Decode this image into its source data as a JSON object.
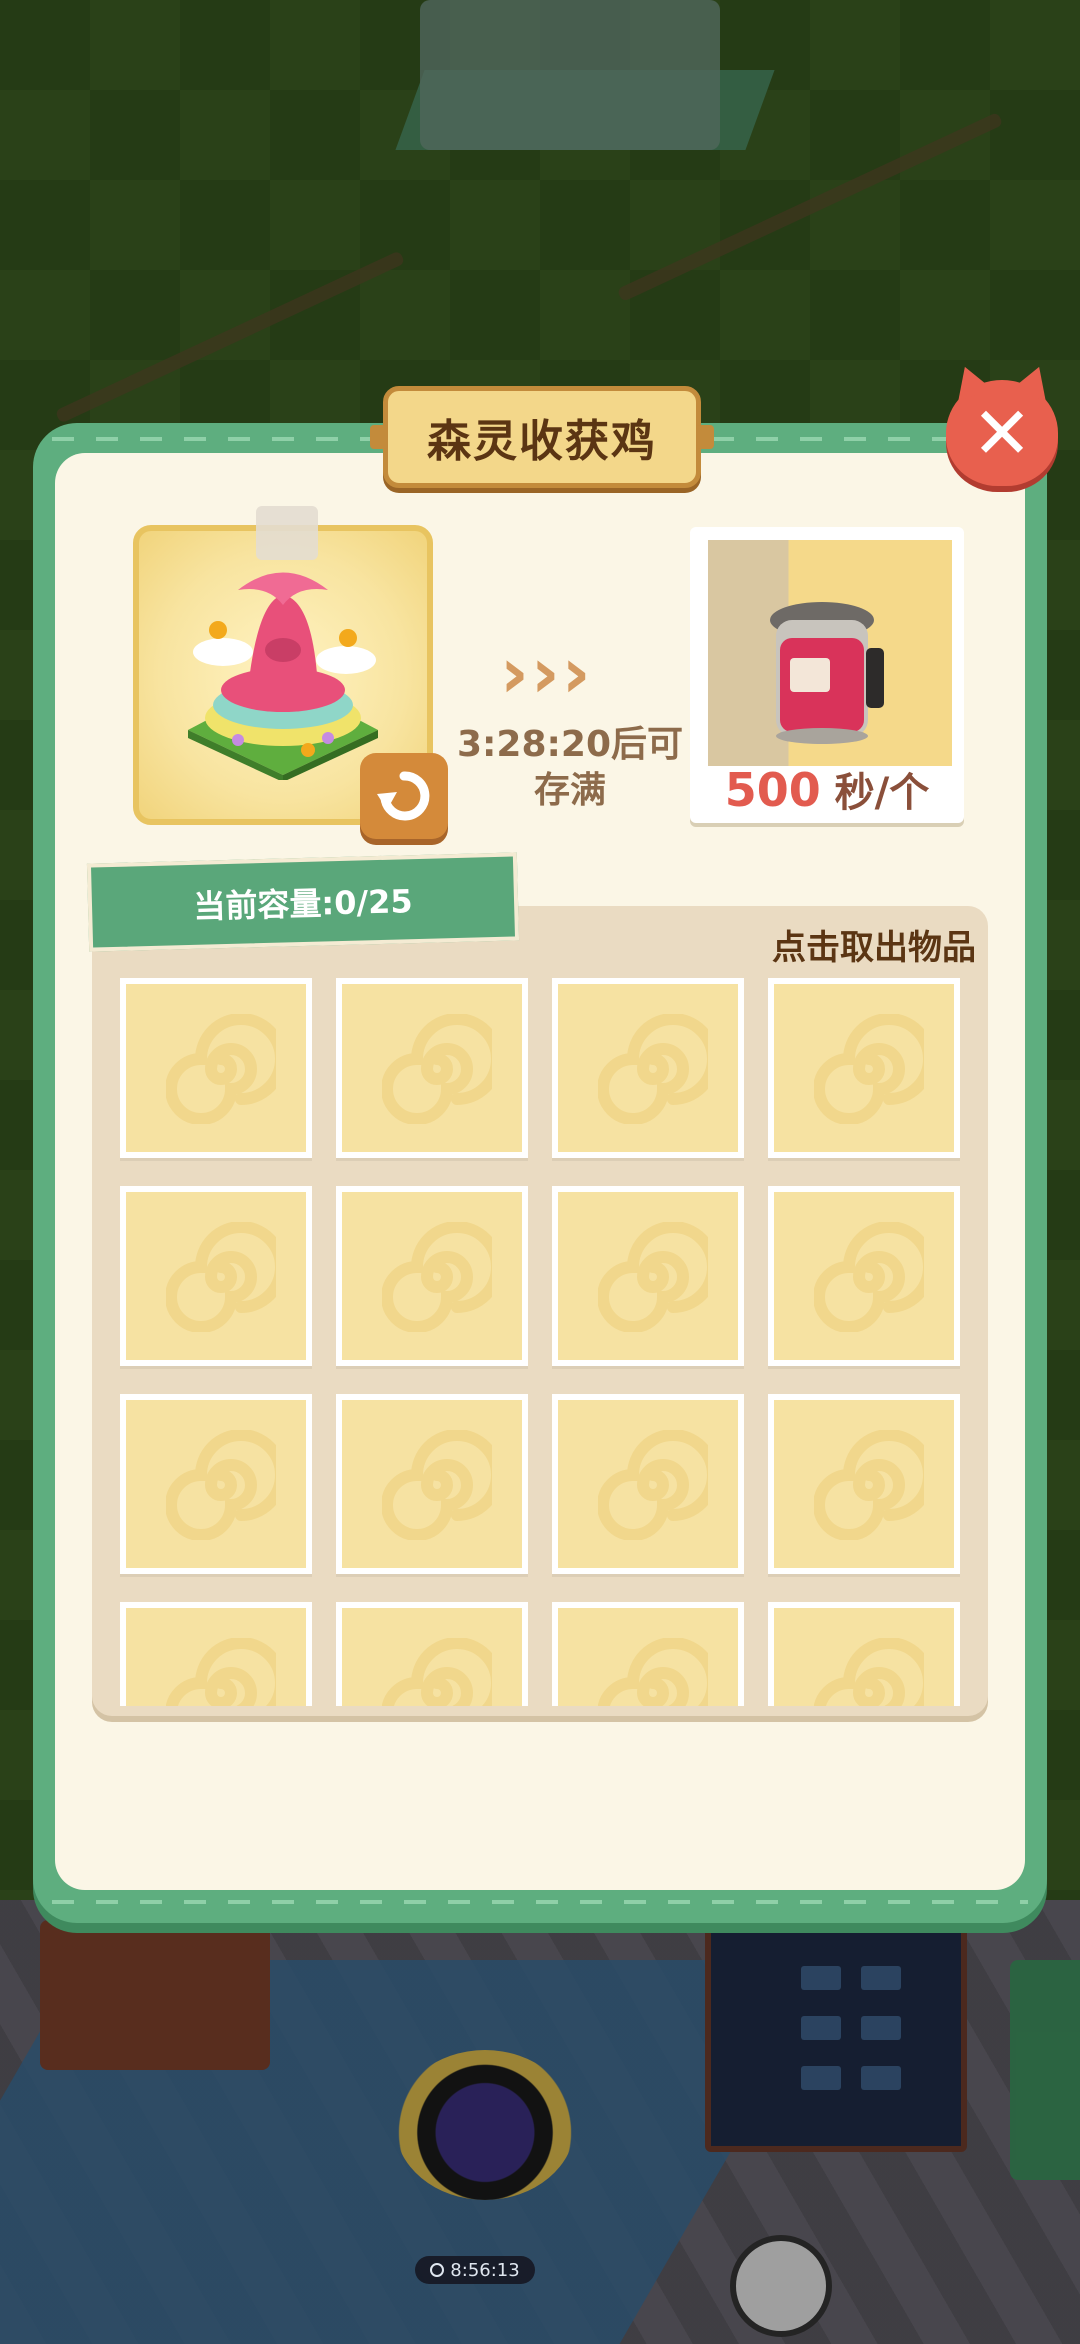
{
  "dialog": {
    "title": "森灵收获鸡",
    "close_label": "✕"
  },
  "production": {
    "countdown": "3:28:20后可存满",
    "rate_value": "500",
    "rate_unit": " 秒/个"
  },
  "storage": {
    "capacity_label": "当前容量:0/25",
    "hint": "点击取出物品",
    "slot_count": 16
  },
  "scene": {
    "event_timer": "8:56:13"
  },
  "colors": {
    "panel_green": "#5eae7f",
    "panel_cream": "#fbf6e6",
    "slot_yellow": "#f6e2a2",
    "accent_red": "#e25b4f"
  }
}
